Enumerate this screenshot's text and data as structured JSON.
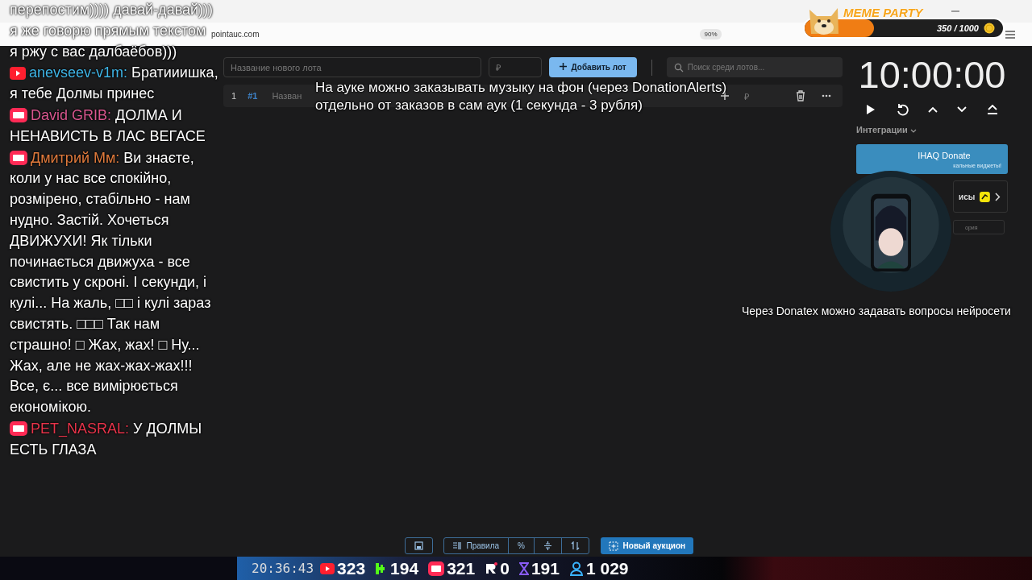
{
  "browser": {
    "url": "pointauc.com",
    "zoom": "90%"
  },
  "meme_party": {
    "title": "MEME PARTY",
    "progress": "350 / 1000",
    "level": 0.35
  },
  "chat": {
    "earlier_lines": [
      "перепостим)))) давай-давай)))",
      "я же говорю прямым текстом",
      "я ржу с вас далбаёбов)))"
    ],
    "messages": [
      {
        "kind": "youtube",
        "author": "anevseev-v1m:",
        "color": "#3fb6e8",
        "text": "Братииишка, я тебе Долмы принес"
      },
      {
        "kind": "vklive",
        "author": "David GRIB:",
        "color": "#d9578f",
        "text": "ДОЛМА И НЕНАВИСТЬ В ЛАС ВЕГАСЕ"
      },
      {
        "kind": "vklive",
        "author": "Дмитрий Мм:",
        "color": "#e07a3c",
        "text": "Ви знаєте, коли у нас все спокійно, розмірено, стабільно - нам нудно. Застій. Хочеться ДВИЖУХИ! Як тільки починається движуха - все свистить у скроні. І секунди, і кулі... На жаль, □□ і кулі зараз свистять. □□□ Так нам страшно! □ Жах, жах! □ Ну... Жах, але не жах-жах-жах!!! Все, є... все вимірюється економікою."
      },
      {
        "kind": "vklive",
        "author": "PET_NASRAL:",
        "color": "#e8344a",
        "text": "У ДОЛМЫ ЕСТЬ ГЛАЗА"
      }
    ]
  },
  "lot_form": {
    "name_placeholder": "Название нового лота",
    "amount_placeholder": "₽",
    "add_button": "Добавить лот",
    "search_placeholder": "Поиск среди лотов..."
  },
  "lots": [
    {
      "index": "1",
      "id": "#1",
      "name": "Назван",
      "amount_placeholder": "₽"
    }
  ],
  "overlay_captions": [
    "На ауке можно заказывать музыку на фон (через DonationAlerts)",
    "отдельно от заказов в сам аук (1 секунда - 3 рубля)"
  ],
  "timer": {
    "time": "10:00:00"
  },
  "integrations": {
    "label": "Интеграции",
    "cards": [
      {
        "kind": "banner",
        "title": "IHAQ Donate",
        "subtitle": "кальные виджеты!"
      },
      {
        "kind": "service",
        "title": "исы"
      },
      {
        "kind": "field",
        "title": "ория"
      }
    ]
  },
  "donatex_caption": "Через Donatex можно задавать вопросы нейросети",
  "toolbar": {
    "rules": "Правила",
    "percent": "%",
    "new_auction": "Новый аукцион"
  },
  "stream_bar": {
    "clock": "20:36:43",
    "stats": [
      {
        "kind": "youtube",
        "count": "323"
      },
      {
        "kind": "kick",
        "count": "194"
      },
      {
        "kind": "vklive",
        "count": "321"
      },
      {
        "kind": "rutube",
        "count": "0"
      },
      {
        "kind": "twitch",
        "count": "191"
      },
      {
        "kind": "viewers",
        "count": "1 029"
      }
    ]
  }
}
